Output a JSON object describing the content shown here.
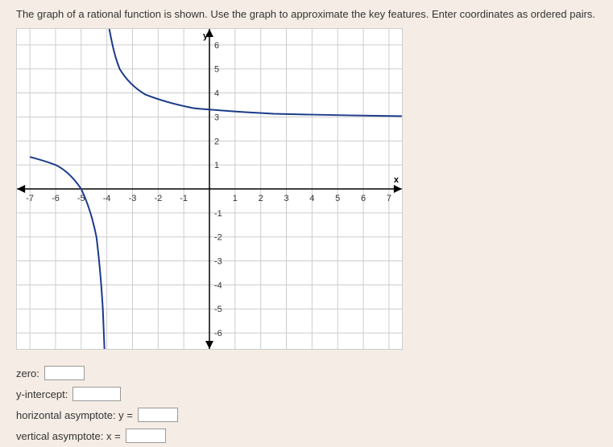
{
  "instruction": "The graph of a rational function is shown. Use the graph to approximate the key features. Enter coordinates as ordered pairs.",
  "answers": {
    "zero_label": "zero:",
    "yint_label": "y-intercept:",
    "hasymp_label": "horizontal asymptote: y =",
    "vasymp_label": "vertical asymptote: x ="
  },
  "chart_data": {
    "type": "line",
    "title": "",
    "xlabel": "x",
    "ylabel": "y",
    "xlim": [
      -7,
      7
    ],
    "ylim": [
      -6,
      6
    ],
    "x_ticks": [
      -7,
      -6,
      -5,
      -4,
      -3,
      -2,
      -1,
      0,
      1,
      2,
      3,
      4,
      5,
      6,
      7
    ],
    "y_ticks": [
      -6,
      -5,
      -4,
      -3,
      -2,
      -1,
      0,
      1,
      2,
      3,
      4,
      5,
      6
    ],
    "series": [
      {
        "name": "left-branch",
        "x": [
          -7,
          -6.5,
          -6,
          -5.5,
          -5,
          -4.8,
          -4.6,
          -4.5,
          -4.4,
          -4.3,
          -4.2,
          -4.1
        ],
        "y": [
          1.33,
          1.2,
          1.0,
          0.67,
          0.0,
          -0.5,
          -1.5,
          -2.0,
          -3.0,
          -4.33,
          -6.0,
          -8.0
        ]
      },
      {
        "name": "right-branch",
        "x": [
          -3.9,
          -3.8,
          -3.7,
          -3.5,
          -3,
          -2.5,
          -2,
          -1,
          0,
          1,
          2,
          3,
          4,
          5,
          6,
          7
        ],
        "y": [
          12.0,
          10.0,
          8.33,
          6.0,
          5.0,
          4.33,
          4.0,
          3.67,
          3.5,
          3.4,
          3.33,
          3.29,
          3.25,
          3.22,
          3.2,
          3.18
        ]
      }
    ],
    "asymptotes": {
      "vertical_x": -4,
      "horizontal_y": 3
    },
    "approximate_features": {
      "zero": "(-5, 0)",
      "y_intercept": "(0, 3.5)",
      "horizontal_asymptote_y": 3,
      "vertical_asymptote_x": -4
    }
  }
}
